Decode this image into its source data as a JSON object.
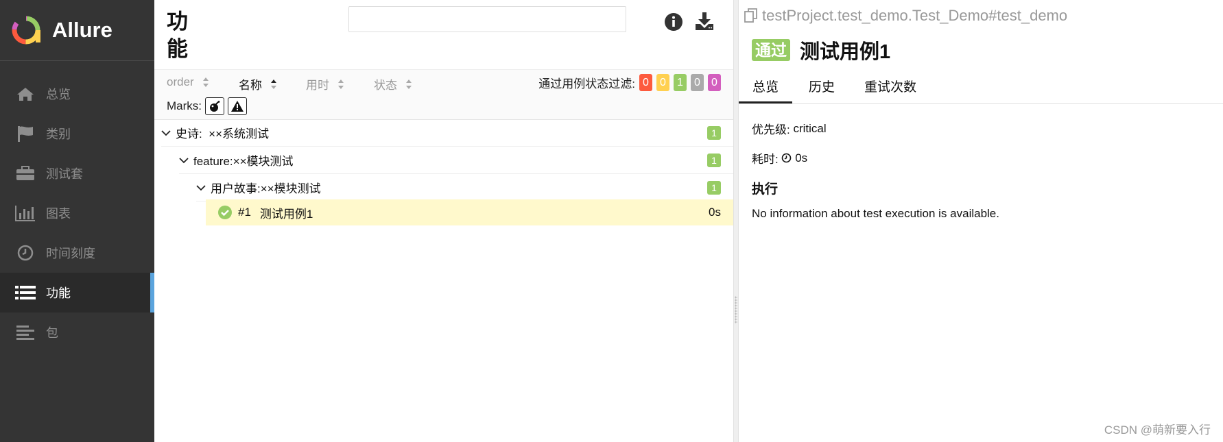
{
  "app": {
    "brand": "Allure"
  },
  "sidebar": {
    "items": [
      {
        "label": "总览",
        "icon": "home-icon"
      },
      {
        "label": "类别",
        "icon": "flag-icon"
      },
      {
        "label": "测试套",
        "icon": "briefcase-icon"
      },
      {
        "label": "图表",
        "icon": "bar-chart-icon"
      },
      {
        "label": "时间刻度",
        "icon": "clock-icon"
      },
      {
        "label": "功能",
        "icon": "list-icon",
        "active": true
      },
      {
        "label": "包",
        "icon": "align-left-icon"
      }
    ]
  },
  "main": {
    "title": "功能",
    "search": {
      "value": "",
      "placeholder": ""
    },
    "sort": {
      "order": "order",
      "name": "名称",
      "duration": "用时",
      "status": "状态"
    },
    "filter": {
      "label": "通过用例状态过滤:",
      "counts": [
        {
          "value": "0",
          "color": "#fd5a3e"
        },
        {
          "value": "0",
          "color": "#ffd050"
        },
        {
          "value": "1",
          "color": "#97cc64"
        },
        {
          "value": "0",
          "color": "#aaaaaa"
        },
        {
          "value": "0",
          "color": "#d35ebe"
        }
      ]
    },
    "marks_label": "Marks:",
    "tree": [
      {
        "text": "史诗:  ××系统测试",
        "count": "1"
      },
      {
        "text": "feature:××模块测试",
        "count": "1"
      },
      {
        "text": "用户故事:××模块测试",
        "count": "1"
      }
    ],
    "leaf": {
      "num": "#1",
      "name": "测试用例1",
      "duration": "0s"
    }
  },
  "detail": {
    "path": "testProject.test_demo.Test_Demo#test_demo",
    "status": "通过",
    "title": "测试用例1",
    "tabs": [
      "总览",
      "历史",
      "重试次数"
    ],
    "severity_label": "优先级:",
    "severity": "critical",
    "duration_label": "耗时:",
    "duration": "0s",
    "execution_heading": "执行",
    "execution_note": "No information about test execution is available."
  },
  "watermark": "CSDN @萌新要入行",
  "colors": {
    "sidebar_bg": "#343434",
    "accent": "#5ba4dd",
    "passed": "#97cc64",
    "selected_row": "#fff9cc"
  }
}
